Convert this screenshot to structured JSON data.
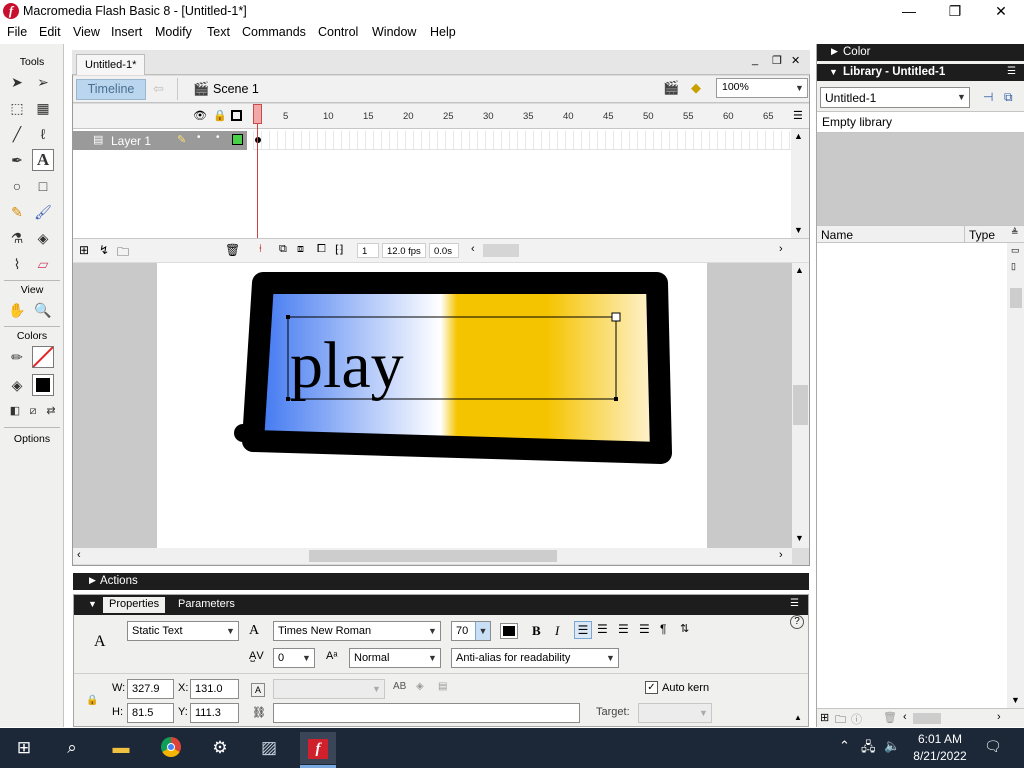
{
  "window": {
    "title": "Macromedia Flash Basic 8 - [Untitled-1*]",
    "app_icon_glyph": "f",
    "minimize_glyph": "—",
    "maximize_glyph": "❐",
    "close_glyph": "✕"
  },
  "menu": [
    "File",
    "Edit",
    "View",
    "Insert",
    "Modify",
    "Text",
    "Commands",
    "Control",
    "Window",
    "Help"
  ],
  "tools": {
    "header": "Tools",
    "view_header": "View",
    "colors_header": "Colors",
    "options_header": "Options"
  },
  "document": {
    "tab": "Untitled-1*",
    "timeline_button": "Timeline",
    "scene": "Scene 1",
    "zoom": "100%",
    "win_min": "_",
    "win_restore": "❐",
    "win_close": "✕"
  },
  "timeline": {
    "ruler": [
      "5",
      "10",
      "15",
      "20",
      "25",
      "30",
      "35",
      "40",
      "45",
      "50",
      "55",
      "60",
      "65"
    ],
    "layer_name": "Layer 1",
    "current_frame": "1",
    "fps": "12.0 fps",
    "elapsed": "0.0s"
  },
  "stage": {
    "text": "play",
    "gradient_colors": [
      "#3a73f0",
      "#ffffff",
      "#f5c400",
      "#fff6e0"
    ]
  },
  "actions_panel": {
    "title": "Actions"
  },
  "properties": {
    "tab_properties": "Properties",
    "tab_parameters": "Parameters",
    "text_type": "Static Text",
    "font": "Times New Roman",
    "size": "70",
    "letter_spacing": "0",
    "position": "Normal",
    "antialias": "Anti-alias for readability",
    "bold": "B",
    "italic": "I",
    "auto_kern_label": "Auto kern",
    "auto_kern_checked": true,
    "w_label": "W:",
    "w": "327.9",
    "h_label": "H:",
    "h": "81.5",
    "x_label": "X:",
    "x": "131.0",
    "y_label": "Y:",
    "y": "111.3",
    "target_label": "Target:"
  },
  "right_panels": {
    "color_title": "Color",
    "library_title": "Library - Untitled-1",
    "library_select": "Untitled-1",
    "empty_library": "Empty library",
    "col_name": "Name",
    "col_type": "Type"
  },
  "taskbar": {
    "time": "6:01 AM",
    "date": "8/21/2022"
  }
}
